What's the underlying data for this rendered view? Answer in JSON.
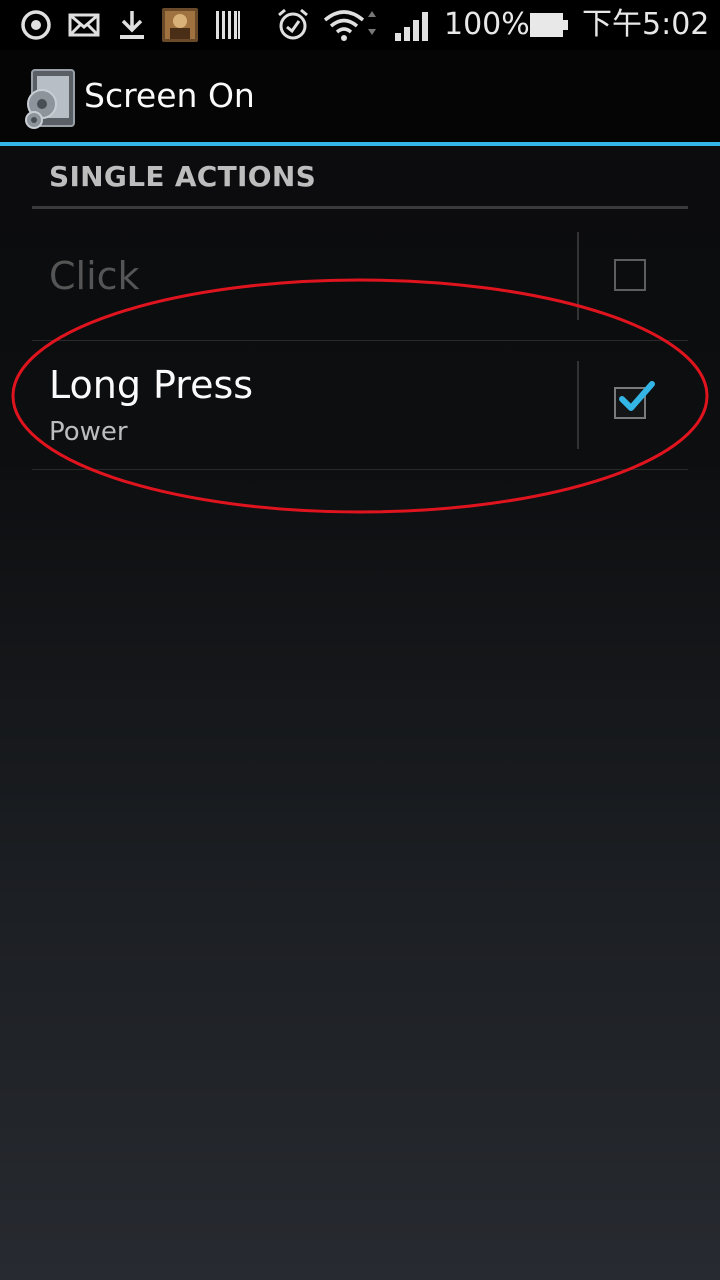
{
  "status_bar": {
    "battery_percent": "100%",
    "time": "下午5:02",
    "icons": [
      "sync-icon",
      "mail-icon",
      "download-icon",
      "app-thumbnail-icon",
      "barcode-icon",
      "alarm-icon",
      "wifi-icon",
      "signal-icon",
      "battery-icon"
    ]
  },
  "action_bar": {
    "title": "Screen On",
    "icon": "screen-settings-icon"
  },
  "section": {
    "header": "SINGLE ACTIONS"
  },
  "preferences": [
    {
      "title": "Click",
      "summary": "",
      "checked": false,
      "enabled": false
    },
    {
      "title": "Long Press",
      "summary": "Power",
      "checked": true,
      "enabled": true
    }
  ],
  "colors": {
    "accent": "#33b5e5",
    "annotation": "#e0141e",
    "disabled_text": "#555555",
    "summary_text": "#bdbdbd"
  }
}
